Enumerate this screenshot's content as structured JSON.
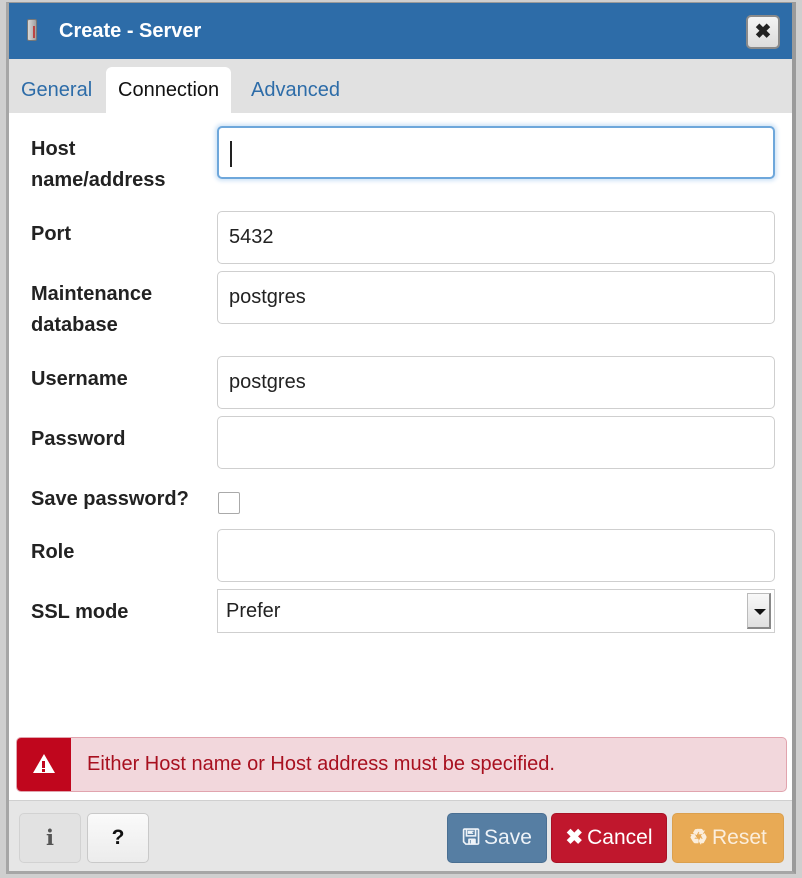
{
  "window": {
    "title": "Create - Server",
    "title_icon": "server-icon",
    "close_icon": "close-icon",
    "close_glyph": "✖"
  },
  "tabs": [
    {
      "label": "General",
      "active": false
    },
    {
      "label": "Connection",
      "active": true
    },
    {
      "label": "Advanced",
      "active": false
    }
  ],
  "form": {
    "host": {
      "label_line1": "Host",
      "label_line2": "name/address",
      "value": ""
    },
    "port": {
      "label": "Port",
      "value": "5432"
    },
    "maintenance_db": {
      "label_line1": "Maintenance",
      "label_line2": "database",
      "value": "postgres"
    },
    "username": {
      "label": "Username",
      "value": "postgres"
    },
    "password": {
      "label": "Password",
      "value": ""
    },
    "save_password": {
      "label": "Save password?",
      "checked": false
    },
    "role": {
      "label": "Role",
      "value": ""
    },
    "ssl_mode": {
      "label": "SSL mode",
      "value": "Prefer"
    }
  },
  "alert": {
    "icon": "warning-icon",
    "message": "Either Host name or Host address must be specified."
  },
  "footer": {
    "info_glyph": "i",
    "help_glyph": "?",
    "save_label": "Save",
    "save_glyph": "🖫",
    "cancel_label": "Cancel",
    "cancel_glyph": "✖",
    "reset_label": "Reset",
    "reset_glyph": "♻"
  },
  "colors": {
    "titlebar": "#2d6ca8",
    "save": "#567ea3",
    "cancel": "#c0172d",
    "reset": "#e8aa55",
    "alert_bg": "#f2d7dc",
    "alert_text": "#a8101f"
  }
}
